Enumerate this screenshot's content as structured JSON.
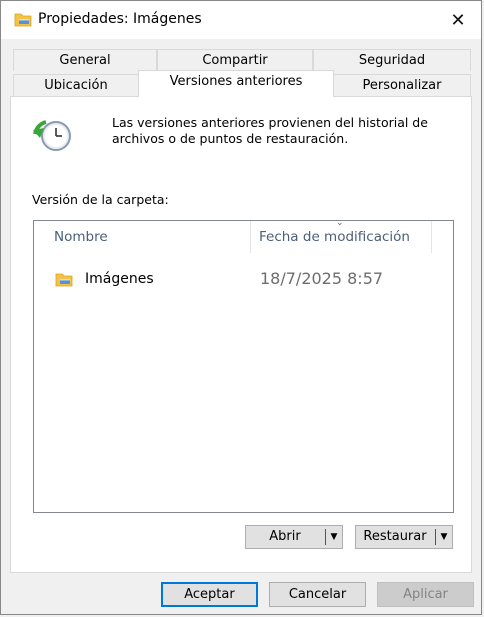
{
  "window": {
    "title": "Propiedades: Imágenes",
    "close_glyph": "✕"
  },
  "tabs": {
    "row1": [
      {
        "label": "General"
      },
      {
        "label": "Compartir"
      },
      {
        "label": "Seguridad"
      }
    ],
    "row2": [
      {
        "label": "Ubicación"
      },
      {
        "label": "Versiones anteriores",
        "active": true
      },
      {
        "label": "Personalizar"
      }
    ]
  },
  "panel": {
    "icon": "restore-clock-icon",
    "info": "Las versiones anteriores provienen del historial de archivos o de puntos de restauración.",
    "section_label": "Versión de la carpeta:",
    "list": {
      "columns": [
        "Nombre",
        "Fecha de modificación"
      ],
      "sort_glyph": "⌄",
      "rows": [
        {
          "name": "Imágenes",
          "date": "18/7/2025 8:57",
          "icon": "folder-icon"
        }
      ]
    },
    "buttons": {
      "open": "Abrir",
      "restore": "Restaurar",
      "arrow_glyph": "▼"
    }
  },
  "footer": {
    "ok": "Aceptar",
    "cancel": "Cancelar",
    "apply": "Aplicar"
  },
  "colors": {
    "accent": "#0078d7",
    "header_text": "#4c607a",
    "folder": "#f3c344"
  }
}
